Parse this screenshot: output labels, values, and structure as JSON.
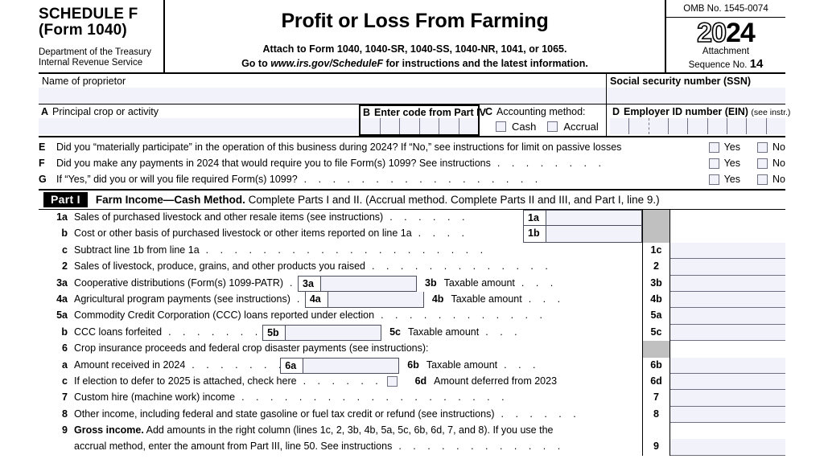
{
  "header": {
    "schedule_line1": "SCHEDULE F",
    "schedule_line2": "(Form 1040)",
    "dept_line1": "Department of the Treasury",
    "dept_line2": "Internal Revenue Service",
    "title": "Profit or Loss From Farming",
    "attach_line": "Attach to Form 1040, 1040-SR, 1040-SS, 1040-NR, 1041, or 1065.",
    "goto_prefix": "Go to ",
    "goto_url": "www.irs.gov/ScheduleF",
    "goto_suffix": " for instructions and the latest information.",
    "omb": "OMB No. 1545-0074",
    "year_hollow": "20",
    "year_solid": "24",
    "attachment_label": "Attachment",
    "sequence_label": "Sequence No.",
    "sequence_no": "14"
  },
  "identity": {
    "name_label": "Name of proprietor",
    "name_value": "",
    "ssn_label": "Social security number (SSN)",
    "ssn_value": ""
  },
  "abcd": {
    "a_letter": "A",
    "a_label": "Principal crop or activity",
    "a_value": "",
    "b_letter": "B",
    "b_label": "Enter code from Part IV",
    "b_value": "",
    "c_letter": "C",
    "c_label": "Accounting method:",
    "c_cash": "Cash",
    "c_accrual": "Accrual",
    "d_letter": "D",
    "d_label": "Employer ID number (EIN)",
    "d_note": "(see instr.)",
    "d_value": ""
  },
  "questions": {
    "yes": "Yes",
    "no": "No",
    "items": [
      {
        "letter": "E",
        "text": "Did you “materially participate” in the operation of this business during 2024? If “No,” see instructions for limit on passive losses",
        "leader": ""
      },
      {
        "letter": "F",
        "text": "Did you make any payments in 2024 that would require you to file Form(s) 1099? See instructions",
        "leader": ". . . . . . . ."
      },
      {
        "letter": "G",
        "text": "If “Yes,” did you or will you file required Form(s) 1099?",
        "leader": ". . . . . . . . . . . . . . . . ."
      }
    ]
  },
  "part1": {
    "tag": "Part I",
    "title_bold": "Farm Income—Cash Method.",
    "title_rest": " Complete Parts I and II. (Accrual method. Complete Parts II and III, and Part I, line 9.)"
  },
  "lines": {
    "l1a": {
      "num": "1a",
      "desc": "Sales of purchased livestock and other resale items (see instructions)",
      "dots": ". . . . . .",
      "tag": "1a",
      "value": ""
    },
    "l1b": {
      "num": "b",
      "desc": "Cost or other basis of purchased livestock or other items reported on line 1a",
      "dots": ". . . .",
      "tag": "1b",
      "value": ""
    },
    "l1c": {
      "num": "c",
      "desc": "Subtract line 1b from line 1a",
      "dots": ". . . . . . . . . . . . . . . . . . . .",
      "rnum": "1c",
      "value": ""
    },
    "l2": {
      "num": "2",
      "desc": "Sales of livestock, produce, grains, and other products you raised",
      "dots": ". . . . . . . . . . . . .",
      "rnum": "2",
      "value": ""
    },
    "l3a": {
      "num": "3a",
      "desc": "Cooperative distributions (Form(s) 1099-PATR)",
      "dots": ".",
      "tag": "3a",
      "value": "",
      "mid_num": "3b",
      "mid_text": "Taxable amount",
      "mid_dots": ". . .",
      "rnum": "3b",
      "rvalue": ""
    },
    "l4a": {
      "num": "4a",
      "desc": "Agricultural program payments (see instructions)",
      "dots": ".",
      "tag": "4a",
      "value": "",
      "mid_num": "4b",
      "mid_text": "Taxable amount",
      "mid_dots": ". . .",
      "rnum": "4b",
      "rvalue": ""
    },
    "l5a": {
      "num": "5a",
      "desc": "Commodity Credit Corporation (CCC) loans reported under election",
      "dots": ". . . . . . . . . . . .",
      "rnum": "5a",
      "value": ""
    },
    "l5b": {
      "num": "b",
      "desc": "CCC loans forfeited",
      "dots": ". . . . . . . . . .",
      "tag": "5b",
      "value": "",
      "mid_num": "5c",
      "mid_text": "Taxable amount",
      "mid_dots": ". . .",
      "rnum": "5c",
      "rvalue": ""
    },
    "l6": {
      "num": "6",
      "desc": "Crop insurance proceeds and federal crop disaster payments (see instructions):"
    },
    "l6a": {
      "num": "a",
      "desc": "Amount received in 2024",
      "dots": ". . . . . . . .",
      "tag": "6a",
      "value": "",
      "mid_num": "6b",
      "mid_text": "Taxable amount",
      "mid_dots": ". . .",
      "rnum": "6b",
      "rvalue": ""
    },
    "l6c": {
      "num": "c",
      "desc": "If election to defer to 2025 is attached, check here",
      "dots": ". . . . . . . .",
      "mid_num": "6d",
      "mid_text": "Amount deferred from 2023",
      "rnum": "6d",
      "rvalue": ""
    },
    "l7": {
      "num": "7",
      "desc": "Custom hire (machine work) income",
      "dots": ". . . . . . . . . . . . . . . . . . .",
      "rnum": "7",
      "value": ""
    },
    "l8": {
      "num": "8",
      "desc": "Other income, including federal and state gasoline or fuel tax credit or refund (see instructions)",
      "dots": ". . . . . .",
      "rnum": "8",
      "value": ""
    },
    "l9": {
      "num": "9",
      "desc_bold": "Gross income.",
      "desc_rest": " Add amounts in the right column (lines 1c, 2, 3b, 4b, 5a, 5c, 6b, 6d, 7, and 8). If you use the",
      "desc2": "accrual method, enter the amount from Part III, line 50. See instructions",
      "dots2": ". . . . . . . . . . . .",
      "rnum": "9",
      "value": ""
    }
  },
  "colors": {
    "field": "#f1f2fa",
    "gray_block": "#c0c0c0",
    "rule": "#000000"
  }
}
